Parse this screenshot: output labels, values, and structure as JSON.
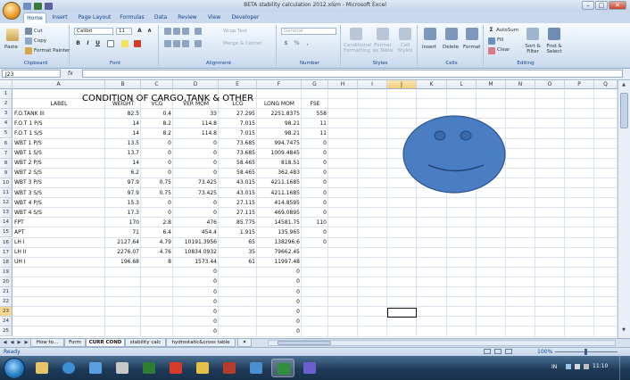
{
  "window": {
    "title": "BETA stability calculation 2012.xlsm - Microsoft Excel"
  },
  "ribbon_tabs": [
    "Home",
    "Insert",
    "Page Layout",
    "Formulas",
    "Data",
    "Review",
    "View",
    "Developer"
  ],
  "clipboard": {
    "paste": "Paste",
    "cut": "Cut",
    "copy": "Copy",
    "format_painter": "Format Painter",
    "group": "Clipboard"
  },
  "font": {
    "name": "Calibri",
    "size": "11",
    "bold": "B",
    "italic": "I",
    "underline": "U",
    "group": "Font"
  },
  "alignment": {
    "wrap_text": "Wrap Text",
    "merge_center": "Merge & Center",
    "group": "Alignment"
  },
  "number": {
    "format": "General",
    "percent": "%",
    "comma": ",",
    "group": "Number"
  },
  "styles": {
    "conditional": "Conditional Formatting",
    "format_table": "Format as Table",
    "cell_styles": "Cell Styles",
    "group": "Styles"
  },
  "cells": {
    "insert": "Insert",
    "delete": "Delete",
    "format": "Format",
    "group": "Cells"
  },
  "editing": {
    "autosum": "AutoSum",
    "fill": "Fill",
    "clear": "Clear",
    "sort_filter": "Sort & Filter",
    "find_select": "Find & Select",
    "group": "Editing"
  },
  "name_box": "J23",
  "fx_label": "fx",
  "columns": [
    "A",
    "B",
    "C",
    "D",
    "E",
    "F",
    "G",
    "H",
    "I",
    "J",
    "K",
    "L",
    "M",
    "N",
    "O",
    "P",
    "Q"
  ],
  "sheet_title": "CONDITION OF CARGO,TANK & OTHER",
  "table_headers": [
    "LABEL",
    "WEIGHT",
    "VCG",
    "VER MOM",
    "LCG",
    "LONG MOM",
    "FSE"
  ],
  "rows": [
    {
      "row": "1",
      "cells": [
        "",
        "",
        "",
        "",
        "",
        "",
        ""
      ]
    },
    {
      "row": "2",
      "cells": [
        "LABEL",
        "WEIGHT",
        "VCG",
        "VER MOM",
        "LCG",
        "LONG MOM",
        "FSE"
      ]
    },
    {
      "row": "3",
      "cells": [
        "F.O.TANK III",
        "82.5",
        "0.4",
        "33",
        "27.295",
        "2251.8375",
        "558"
      ]
    },
    {
      "row": "4",
      "cells": [
        "F.O.T 1 P/S",
        "14",
        "8.2",
        "114.8",
        "7.015",
        "98.21",
        "11"
      ]
    },
    {
      "row": "5",
      "cells": [
        "F.O.T 1 S/S",
        "14",
        "8.2",
        "114.8",
        "7.015",
        "98.21",
        "11"
      ]
    },
    {
      "row": "6",
      "cells": [
        "WBT 1 P/S",
        "13.5",
        "0",
        "0",
        "73.685",
        "994.7475",
        "0"
      ]
    },
    {
      "row": "7",
      "cells": [
        "WBT 1 S/S",
        "13.7",
        "0",
        "0",
        "73.685",
        "1009.4845",
        "0"
      ]
    },
    {
      "row": "8",
      "cells": [
        "WBT 2 P/S",
        "14",
        "0",
        "0",
        "58.465",
        "818.51",
        "0"
      ]
    },
    {
      "row": "9",
      "cells": [
        "WBT 2 S/S",
        "6.2",
        "0",
        "0",
        "58.465",
        "362.483",
        "0"
      ]
    },
    {
      "row": "10",
      "cells": [
        "WBT 3 P/S",
        "97.9",
        "0.75",
        "73.425",
        "43.015",
        "4211.1685",
        "0"
      ]
    },
    {
      "row": "11",
      "cells": [
        "WBT 3 S/S",
        "97.9",
        "0.75",
        "73.425",
        "43.015",
        "4211.1685",
        "0"
      ]
    },
    {
      "row": "12",
      "cells": [
        "WBT 4 P/S",
        "15.3",
        "0",
        "0",
        "27.115",
        "414.8595",
        "0"
      ]
    },
    {
      "row": "13",
      "cells": [
        "WBT 4 S/S",
        "17.3",
        "0",
        "0",
        "27.115",
        "469.0895",
        "0"
      ]
    },
    {
      "row": "14",
      "cells": [
        "FPT",
        "170",
        "2.8",
        "476",
        "85.775",
        "14581.75",
        "110"
      ]
    },
    {
      "row": "15",
      "cells": [
        "APT",
        "71",
        "6.4",
        "454.4",
        "1.915",
        "135.965",
        "0"
      ]
    },
    {
      "row": "16",
      "cells": [
        "LH I",
        "2127.64",
        "4.79",
        "10191.3956",
        "65",
        "138296.6",
        "0"
      ]
    },
    {
      "row": "17",
      "cells": [
        "LH II",
        "2276.07",
        "4.76",
        "10834.0932",
        "35",
        "79662.45",
        ""
      ]
    },
    {
      "row": "18",
      "cells": [
        "UH I",
        "196.68",
        "8",
        "1573.44",
        "61",
        "11997.48",
        ""
      ]
    },
    {
      "row": "19",
      "cells": [
        "",
        "",
        "",
        "0",
        "",
        "0",
        ""
      ]
    },
    {
      "row": "20",
      "cells": [
        "",
        "",
        "",
        "0",
        "",
        "0",
        ""
      ]
    },
    {
      "row": "21",
      "cells": [
        "",
        "",
        "",
        "0",
        "",
        "0",
        ""
      ]
    },
    {
      "row": "22",
      "cells": [
        "",
        "",
        "",
        "0",
        "",
        "0",
        ""
      ]
    },
    {
      "row": "23",
      "cells": [
        "",
        "",
        "",
        "0",
        "",
        "0",
        ""
      ]
    },
    {
      "row": "24",
      "cells": [
        "",
        "",
        "",
        "0",
        "",
        "0",
        ""
      ]
    },
    {
      "row": "25",
      "cells": [
        "",
        "",
        "",
        "0",
        "",
        "0",
        ""
      ]
    }
  ],
  "sheet_tabs": [
    "How to...",
    "Form",
    "CURR COND",
    "stability calc",
    "hydrostatic&cross table"
  ],
  "active_sheet": "CURR COND",
  "status": {
    "mode": "Ready",
    "zoom": "100%"
  },
  "taskbar": {
    "lang": "IN",
    "time": "11:10"
  },
  "colors": {
    "smiley_fill": "#4a7dc2",
    "smiley_stroke": "#2c548f",
    "ribbon_blue": "#15428b"
  }
}
